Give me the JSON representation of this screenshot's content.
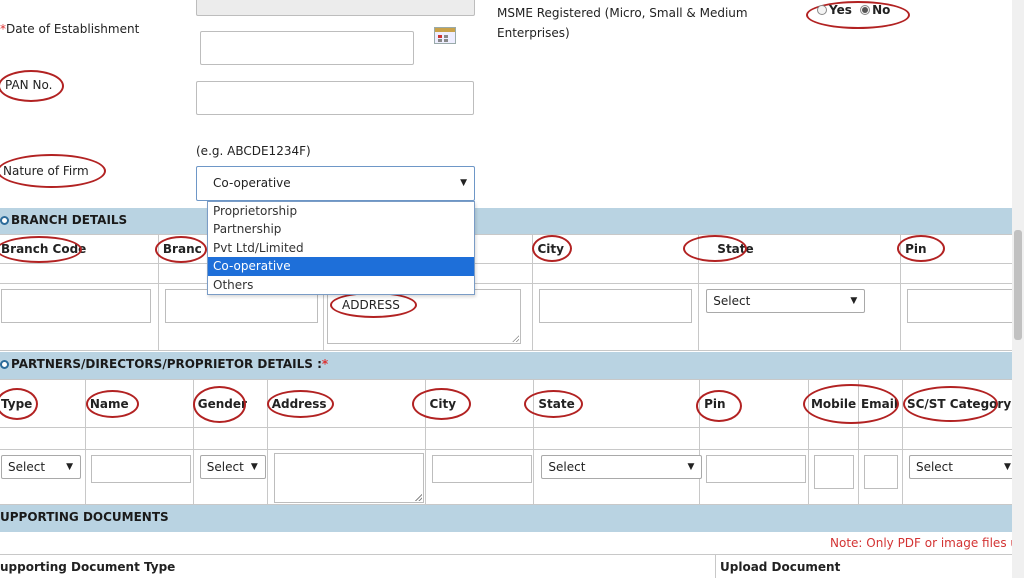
{
  "form": {
    "date_label": "Date of Establishment",
    "required_mark": "*",
    "pan_label": "PAN No.",
    "nature_label": "Nature of Firm",
    "pan_hint": "(e.g. ABCDE1234F)",
    "nature_value": "Co-operative",
    "msme_label_1": "MSME Registered (Micro, Small & Medium",
    "msme_label_2": "Enterprises)",
    "msme_yes": "Yes",
    "msme_no": "No",
    "msme_selected": "No"
  },
  "nature_options": [
    "Proprietorship",
    "Partnership",
    "Pvt Ltd/Limited",
    "Co-operative",
    "Others"
  ],
  "branch": {
    "title": "BRANCH DETAILS",
    "headers": {
      "code": "Branch Code",
      "branch": "Branc",
      "city": "City",
      "state": "State",
      "pin": "Pin"
    },
    "address_placeholder": "ADDRESS",
    "state_select": "Select"
  },
  "partners": {
    "title": "PARTNERS/DIRECTORS/PROPRIETOR DETAILS :",
    "required_mark": "*",
    "headers": {
      "type": "Type",
      "name": "Name",
      "gender": "Gender",
      "address": "Address",
      "city": "City",
      "state": "State",
      "pin": "Pin",
      "mobile": "Mobile",
      "email": "Email",
      "category": "SC/ST Category"
    },
    "type_select": "Select",
    "gender_select": "Select",
    "state_select": "Select",
    "category_select": "Select"
  },
  "documents": {
    "title": "UPPORTING DOCUMENTS",
    "note": "Note: Only PDF or image files u",
    "col_type": "upporting Document Type",
    "col_upload": "Upload Document"
  },
  "colors": {
    "band": "#b9d3e2",
    "annotation": "#b22222",
    "selected_option": "#1e6fd9",
    "note": "#d33333"
  }
}
